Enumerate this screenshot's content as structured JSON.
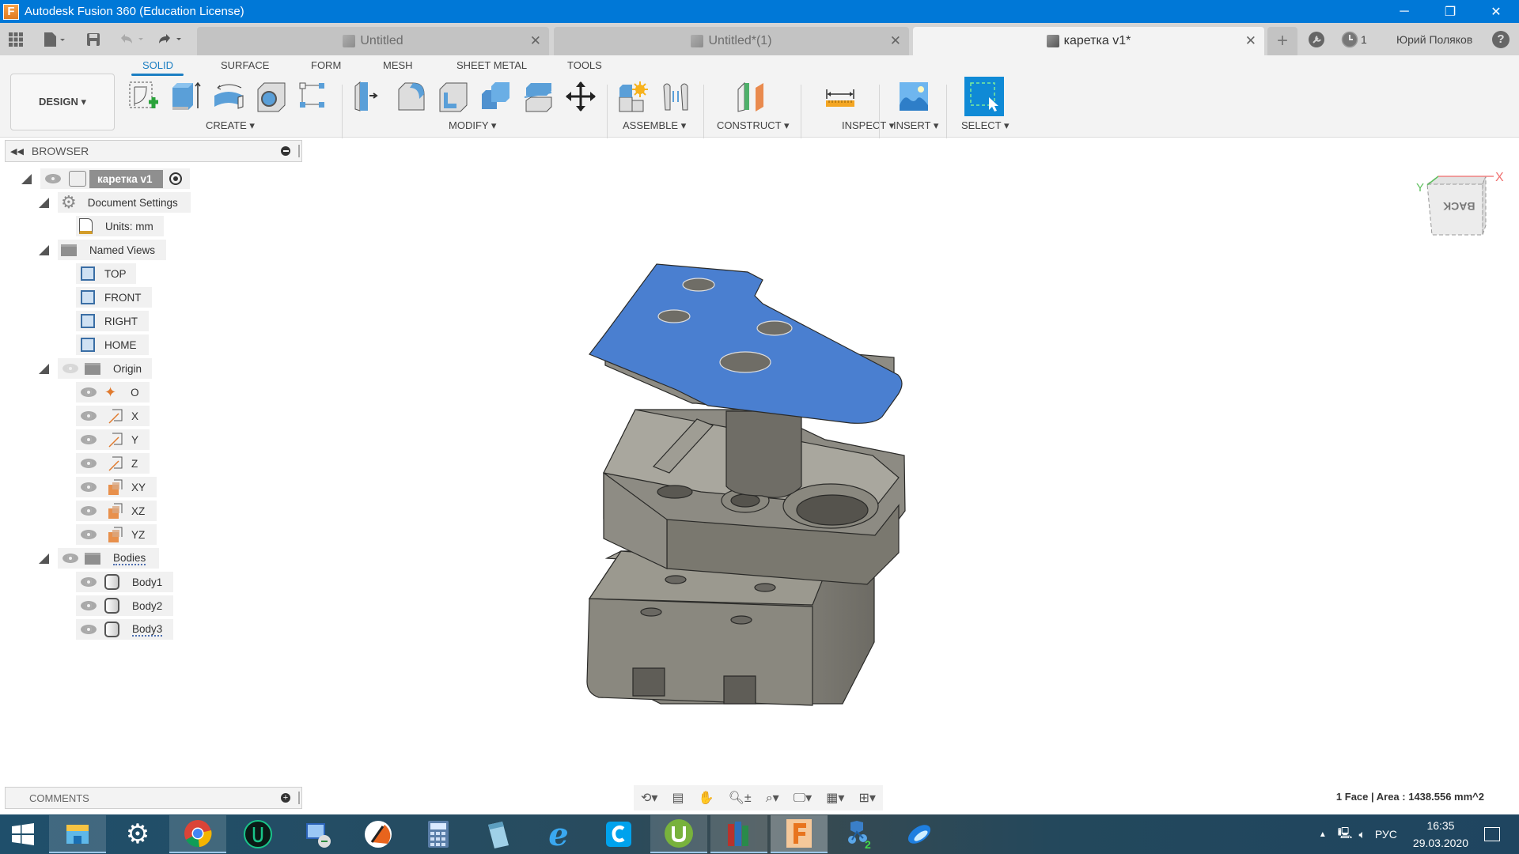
{
  "titlebar": {
    "title": "Autodesk Fusion 360 (Education License)",
    "app_icon": "F"
  },
  "window_controls": {
    "minimize": "─",
    "maximize": "❐",
    "close": "✕"
  },
  "quick_access": {
    "grid": "apps-grid-icon",
    "file": "file-icon",
    "save": "save-icon",
    "undo": "undo-icon",
    "redo": "redo-icon"
  },
  "tabs": [
    {
      "label": "Untitled",
      "active": false
    },
    {
      "label": "Untitled*(1)",
      "active": false
    },
    {
      "label": "каретка v1*",
      "active": true
    }
  ],
  "top_right": {
    "new_tab": "+",
    "jobs_count": "1",
    "user": "Юрий Поляков",
    "help": "?"
  },
  "toolbar": {
    "workspace": "DESIGN ▾",
    "ws_tabs": [
      "SOLID",
      "SURFACE",
      "FORM",
      "MESH",
      "SHEET METAL",
      "TOOLS"
    ],
    "active_ws_tab": "SOLID",
    "groups": [
      "CREATE ▾",
      "MODIFY ▾",
      "ASSEMBLE ▾",
      "CONSTRUCT ▾",
      "INSPECT ▾",
      "INSERT ▾",
      "SELECT ▾"
    ]
  },
  "browser": {
    "title": "BROWSER",
    "root": "каретка v1",
    "items": {
      "document_settings": "Document Settings",
      "units": "Units: mm",
      "named_views": "Named Views",
      "top": "TOP",
      "front": "FRONT",
      "right": "RIGHT",
      "home": "HOME",
      "origin": "Origin",
      "o": "O",
      "x": "X",
      "y": "Y",
      "z": "Z",
      "xy": "XY",
      "xz": "XZ",
      "yz": "YZ",
      "bodies": "Bodies",
      "body1": "Body1",
      "body2": "Body2",
      "body3": "Body3"
    }
  },
  "viewcube": {
    "face": "BACK",
    "axis_x": "X",
    "axis_y": "Y"
  },
  "comments": {
    "title": "COMMENTS"
  },
  "status": {
    "selection": "1 Face | Area : 1438.556 mm^2"
  },
  "colors": {
    "selected_face": "#4a7fd0",
    "body": "#8c8a82",
    "accent": "#1b7ec2",
    "titlebar": "#0078d7"
  },
  "taskbar": {
    "apps": [
      "start",
      "file-explorer",
      "settings",
      "chrome",
      "uplay",
      "remote-desktop",
      "app-orange",
      "calculator",
      "notepad",
      "internet-explorer",
      "app-c",
      "utorrent",
      "books",
      "fusion-360",
      "molecule",
      "app-blue"
    ],
    "tray": {
      "language": "РУС",
      "time": "16:35",
      "date": "29.03.2020"
    }
  }
}
